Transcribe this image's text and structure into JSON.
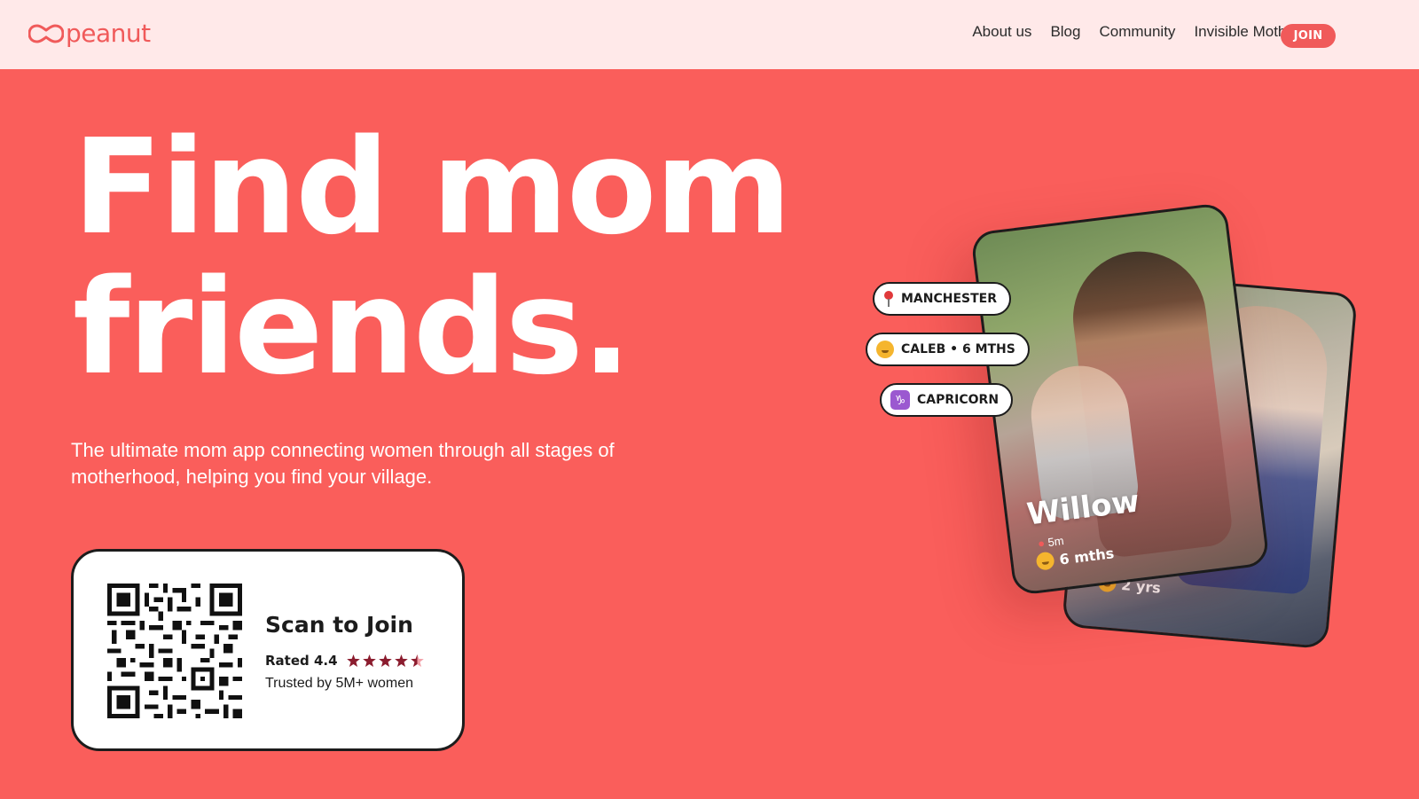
{
  "brand": {
    "name": "peanut",
    "color": "#f05a5a"
  },
  "nav": {
    "items": [
      "About us",
      "Blog",
      "Community",
      "Invisible Mothers"
    ],
    "join_label": "JOIN"
  },
  "hero": {
    "title_line1": "Find mom",
    "title_line2": "friends.",
    "subtitle": "The ultimate mom app connecting women through all stages of motherhood, helping you find your village."
  },
  "qr_card": {
    "title": "Scan to Join",
    "rating_label": "Rated 4.4",
    "rating_value": 4.4,
    "rating_max": 5,
    "trusted": "Trusted by 5M+ women"
  },
  "profile_tags": [
    {
      "icon": "location-pin-icon",
      "label": "MANCHESTER"
    },
    {
      "icon": "baby-emoji-icon",
      "label": "CALEB • 6 MTHS"
    },
    {
      "icon": "capricorn-icon",
      "label": "CAPRICORN"
    }
  ],
  "profile_card": {
    "name": "Willow",
    "distance": "5m",
    "child_age": "6 mths"
  },
  "back_card": {
    "child_age": "2 yrs"
  },
  "colors": {
    "background": "#fa5e5b",
    "header": "#ffe9e9",
    "accent": "#f05a5a",
    "star": "#8b1c2e"
  }
}
